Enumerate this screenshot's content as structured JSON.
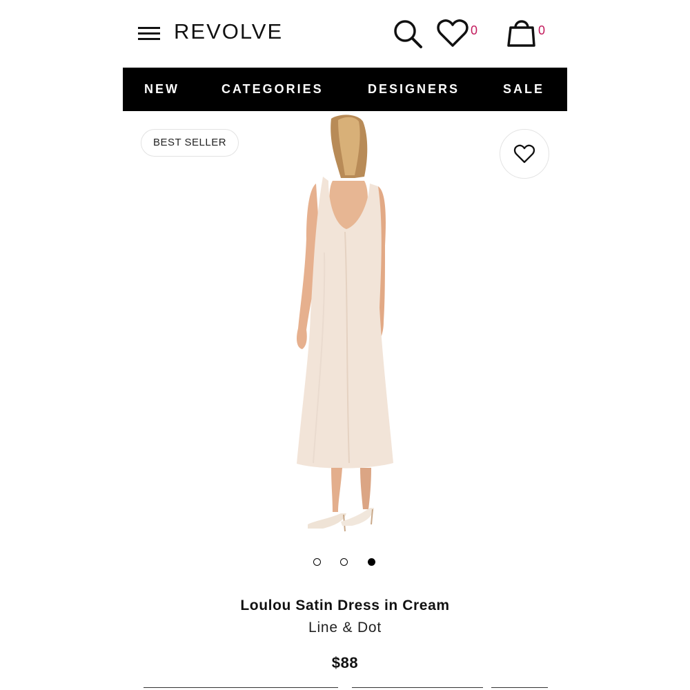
{
  "header": {
    "logo": "REVOLVE",
    "wishlist_count": "0",
    "bag_count": "0",
    "icons": [
      "menu-icon",
      "search-icon",
      "heart-icon",
      "shopping-bag-icon"
    ],
    "count_color": "#c2185b"
  },
  "nav": {
    "items": [
      {
        "label": "NEW"
      },
      {
        "label": "CATEGORIES"
      },
      {
        "label": "DESIGNERS"
      },
      {
        "label": "SALE"
      }
    ],
    "background": "#000000"
  },
  "product": {
    "badge": "BEST SELLER",
    "title": "Loulou Satin Dress in Cream",
    "brand": "Line & Dot",
    "price": "$88",
    "image_count": 3,
    "active_image": 3
  }
}
